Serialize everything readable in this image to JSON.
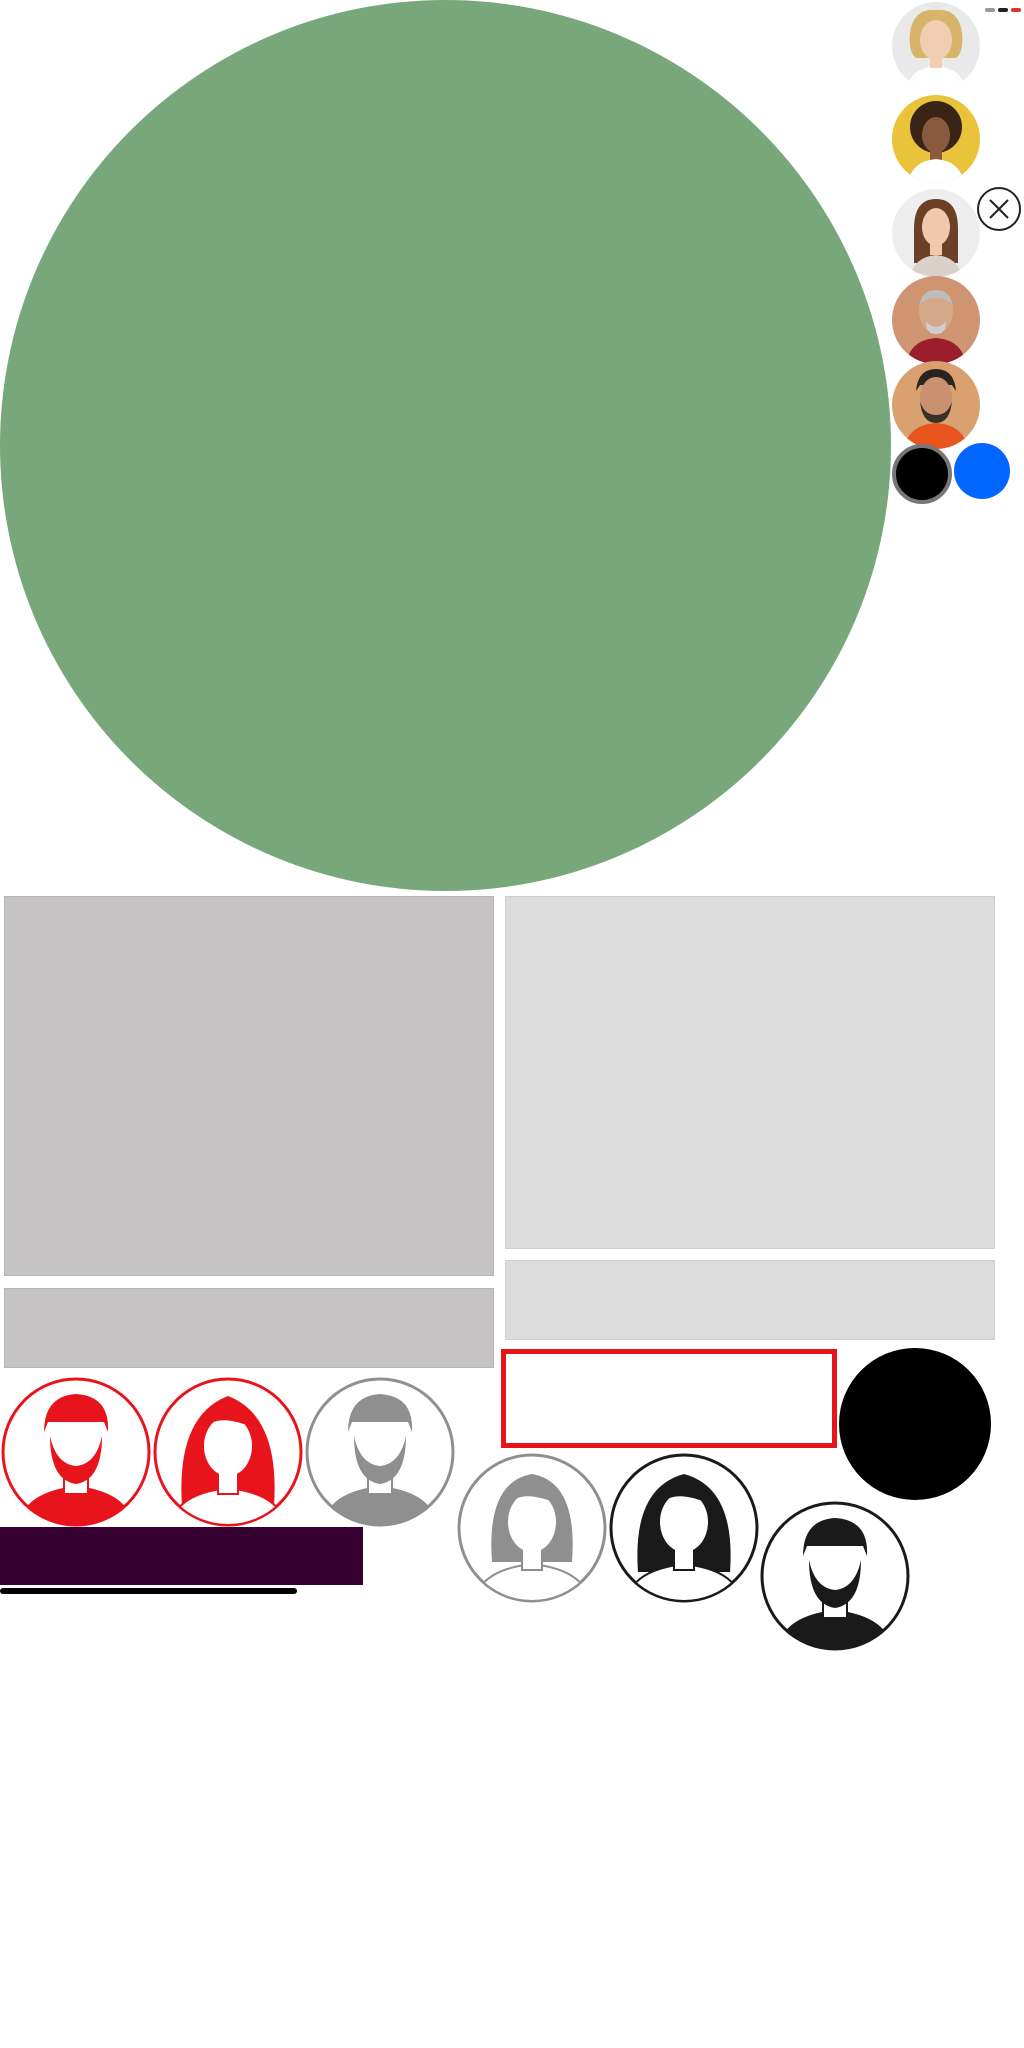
{
  "colors": {
    "big_circle": "#78a77b",
    "panel_left": "#c5c3c4",
    "panel_right": "#dcdcdc",
    "red": "#e8141c",
    "gray_avatar": "#8f8f8f",
    "black_avatar": "#1a1a1a",
    "purple_bar": "#360030",
    "blue_swatch": "#0066ff"
  },
  "profiles": [
    {
      "icon": "woman-blonde-photo",
      "background": "#e9e9ea"
    },
    {
      "icon": "woman-curly-hair-photo",
      "background": "#e9c43a"
    },
    {
      "icon": "woman-brown-hair-photo",
      "background": "#eeeeee"
    },
    {
      "icon": "older-man-photo",
      "background": "#cf9570"
    },
    {
      "icon": "bearded-man-photo",
      "background": "#d9a070"
    }
  ],
  "avatar_icons": [
    {
      "icon": "male-red-icon",
      "color": "#e8141c"
    },
    {
      "icon": "female-red-icon",
      "color": "#e8141c"
    },
    {
      "icon": "male-gray-icon",
      "color": "#8f8f8f"
    },
    {
      "icon": "female-gray-icon",
      "color": "#8f8f8f"
    },
    {
      "icon": "female-black-icon",
      "color": "#1a1a1a"
    },
    {
      "icon": "male-black-icon",
      "color": "#1a1a1a"
    }
  ],
  "controls": {
    "close_icon": "close-icon"
  }
}
